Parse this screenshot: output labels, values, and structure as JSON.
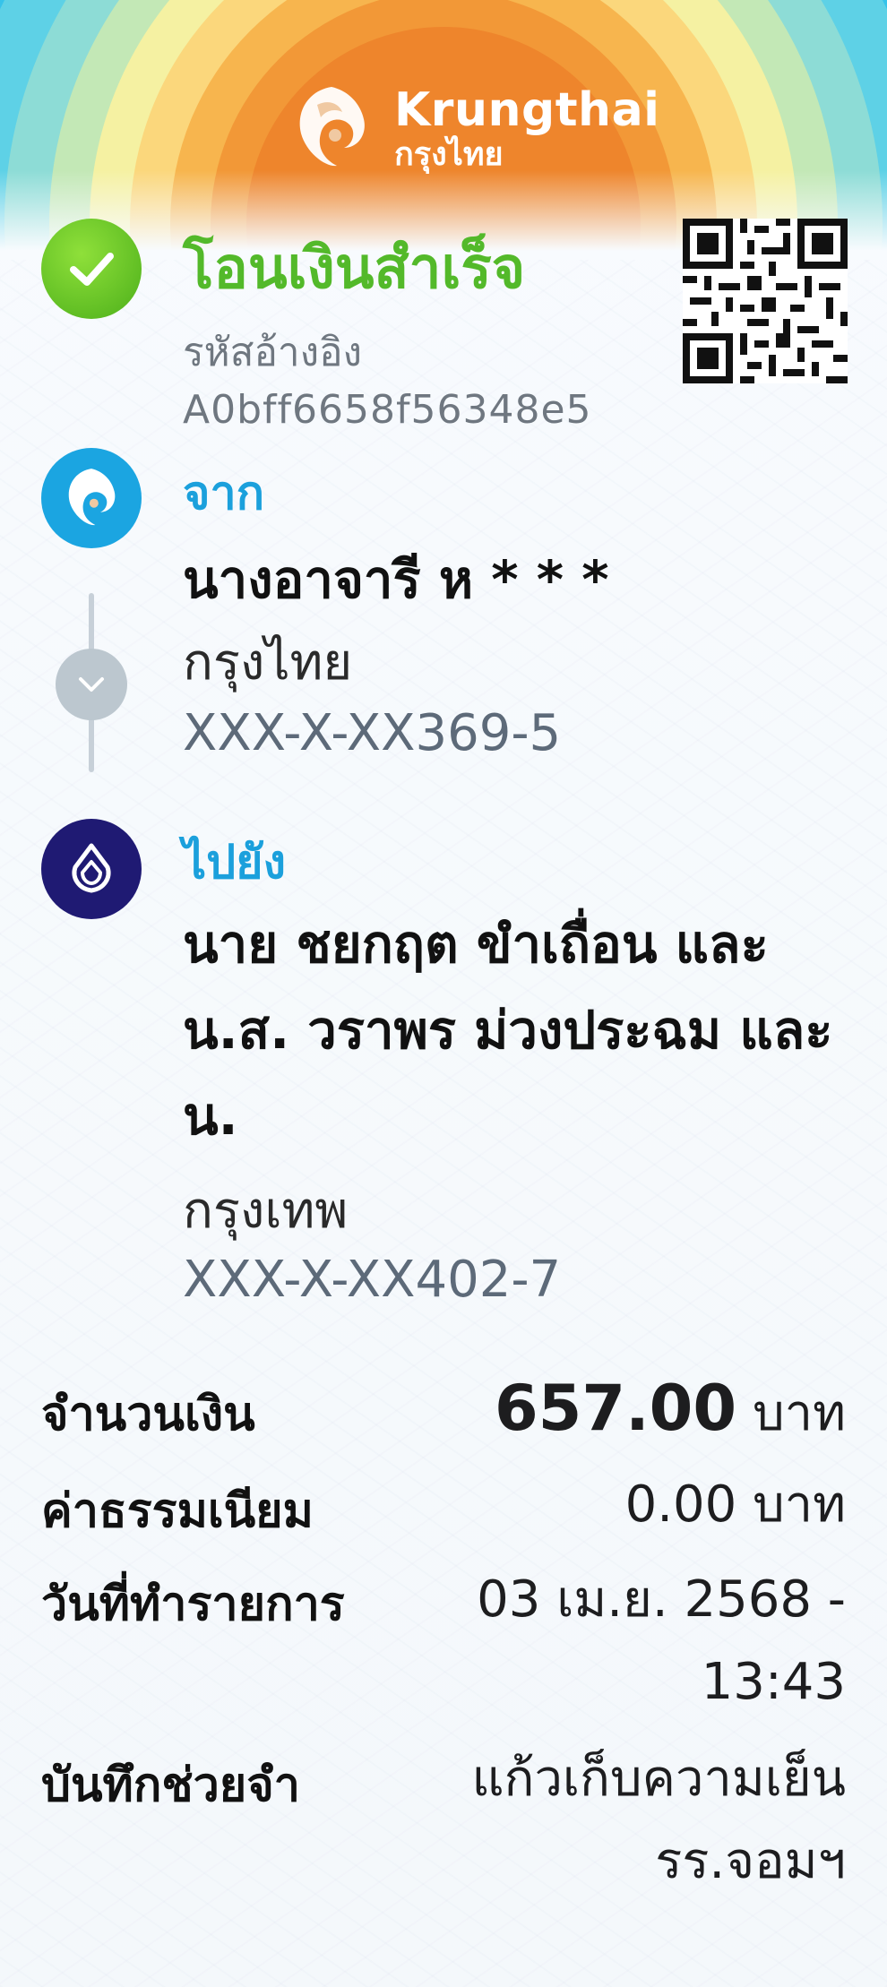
{
  "brand": {
    "name": "Krungthai",
    "name_thai": "กรุงไทย"
  },
  "status": {
    "title": "โอนเงินสำเร็จ",
    "ref_label": "รหัสอ้างอิง",
    "ref_code": "A0bff6658f56348e5"
  },
  "from": {
    "label": "จาก",
    "name": "นางอาจารี ห * * *",
    "bank": "กรุงไทย",
    "account": "XXX-X-XX369-5"
  },
  "to": {
    "label": "ไปยัง",
    "name": "นาย ชยกฤต ขำเถื่อน และ น.ส. วราพร ม่วงประฉม และ น.",
    "bank": "กรุงเทพ",
    "account": "XXX-X-XX402-7"
  },
  "details": {
    "amount_label": "จำนวนเงิน",
    "amount_value": "657.00",
    "amount_unit": "บาท",
    "fee_label": "ค่าธรรมเนียม",
    "fee_value": "0.00 บาท",
    "date_label": "วันที่ทำรายการ",
    "date_value_line1": "03 เม.ย. 2568 -",
    "date_value_line2": "13:43",
    "memo_label": "บันทึกช่วยจำ",
    "memo_value_line1": "แก้วเก็บความเย็น",
    "memo_value_line2": "รร.จอมฯ"
  },
  "colors": {
    "success_green": "#53b92a",
    "ktb_blue": "#1ba5e1",
    "bbl_navy": "#1f1a73",
    "label_blue": "#1ba0dc"
  },
  "icons": {
    "status": "check-icon",
    "from_bank": "krungthai-logo-icon",
    "to_bank": "bangkok-bank-logo-icon",
    "connector": "chevron-down-icon",
    "qr": "qr-code-icon"
  }
}
